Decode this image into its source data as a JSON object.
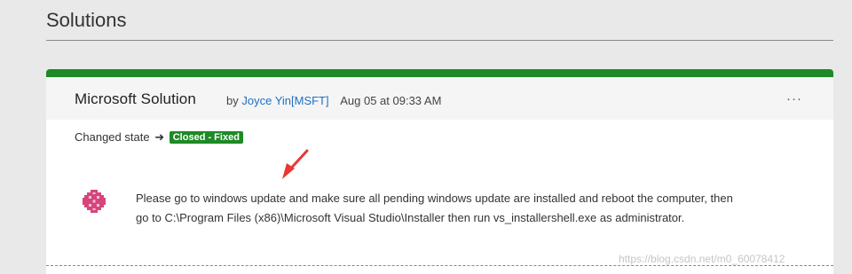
{
  "section": {
    "title": "Solutions"
  },
  "card": {
    "title": "Microsoft Solution",
    "by_label": "by",
    "author": "Joyce Yin[MSFT]",
    "date": "Aug 05 at 09:33 AM",
    "more_label": "···",
    "state_label": "Changed state",
    "state_arrow": "➜",
    "state_badge": "Closed - Fixed",
    "body": "Please go to windows update and make sure all pending windows update are installed and reboot the computer, then go to C:\\Program Files (x86)\\Microsoft Visual Studio\\Installer then run vs_installershell.exe as administrator."
  },
  "watermark": {
    "text": "https://blog.csdn.net/m0_60078412"
  },
  "colors": {
    "accent_green": "#1e8a26",
    "link_blue": "#1f6fc5",
    "avatar_pink": "#d6457d",
    "annotation_red": "#e53935"
  },
  "icons": {
    "avatar": "avatar-icon",
    "more": "more-options-icon",
    "annotation": "red-pointer-arrow-icon"
  }
}
